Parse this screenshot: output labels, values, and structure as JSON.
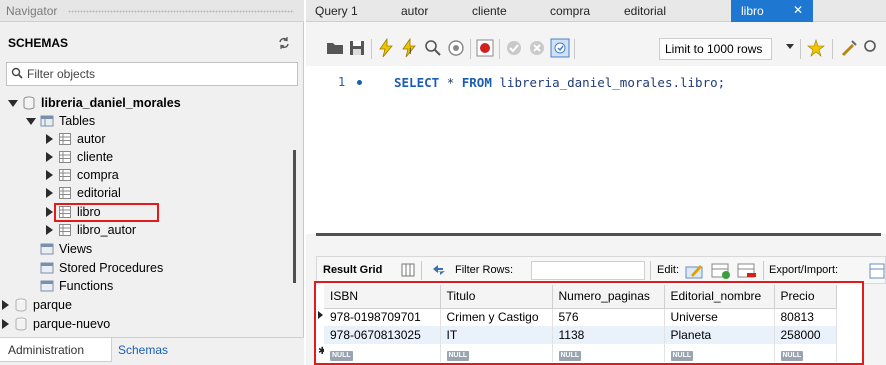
{
  "navigator": {
    "title": "Navigator",
    "schemas_label": "SCHEMAS",
    "filter_placeholder": "Filter objects",
    "tree": {
      "schema_name": "libreria_daniel_morales",
      "tables_label": "Tables",
      "tables": [
        "autor",
        "cliente",
        "compra",
        "editorial",
        "libro",
        "libro_autor"
      ],
      "views_label": "Views",
      "stored_procedures_label": "Stored Procedures",
      "functions_label": "Functions",
      "other_schemas": [
        "parque",
        "parque-nuevo"
      ]
    },
    "tabs": {
      "administration": "Administration",
      "schemas": "Schemas"
    }
  },
  "query_tabs": [
    "Query 1",
    "autor",
    "cliente",
    "compra",
    "editorial",
    "libro"
  ],
  "active_tab": "libro",
  "toolbar": {
    "limit_label": "Limit to 1000 rows"
  },
  "editor": {
    "line_number": "1",
    "sql_kw1": "SELECT",
    "sql_star": "*",
    "sql_kw2": "FROM",
    "sql_rest": "libreria_daniel_morales.libro;"
  },
  "result_toolbar": {
    "result_grid": "Result Grid",
    "filter_rows": "Filter Rows:",
    "edit": "Edit:",
    "export_import": "Export/Import:"
  },
  "grid": {
    "columns": [
      "ISBN",
      "Titulo",
      "Numero_paginas",
      "Editorial_nombre",
      "Precio"
    ],
    "rows": [
      [
        "978-0198709701",
        "Crimen y Castigo",
        "576",
        "Universe",
        "80813"
      ],
      [
        "978-0670813025",
        "IT",
        "1138",
        "Planeta",
        "258000"
      ]
    ],
    "null_label": "NULL"
  },
  "colors": {
    "accent": "#1e78d2",
    "highlight_border": "#e21a1a"
  }
}
